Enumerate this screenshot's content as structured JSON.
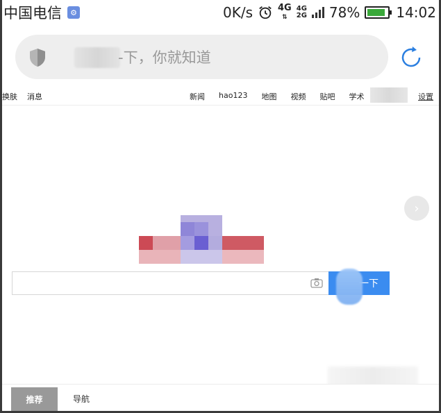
{
  "status_bar": {
    "carrier": "中国电信",
    "net_speed": "0K/s",
    "network_top": "4G",
    "network_stack_top": "4G",
    "network_stack_bottom": "2G",
    "battery_percent": "78%",
    "battery_level": 0.78,
    "time": "14:02"
  },
  "address_bar": {
    "placeholder_suffix": "-下，你就知道"
  },
  "top_nav": {
    "left_items": [
      "换肤",
      "消息"
    ],
    "right_items": [
      "新闻",
      "hao123",
      "地图",
      "视频",
      "贴吧",
      "学术"
    ],
    "settings_label": "设置"
  },
  "search": {
    "button_label": "一下"
  },
  "bottom_tabs": {
    "recommend_label": "推荐",
    "navigation_label": "导航"
  },
  "colors": {
    "accent_blue": "#3b8cf0",
    "battery_green": "#3aa83a",
    "tab_active_bg": "#999999"
  }
}
